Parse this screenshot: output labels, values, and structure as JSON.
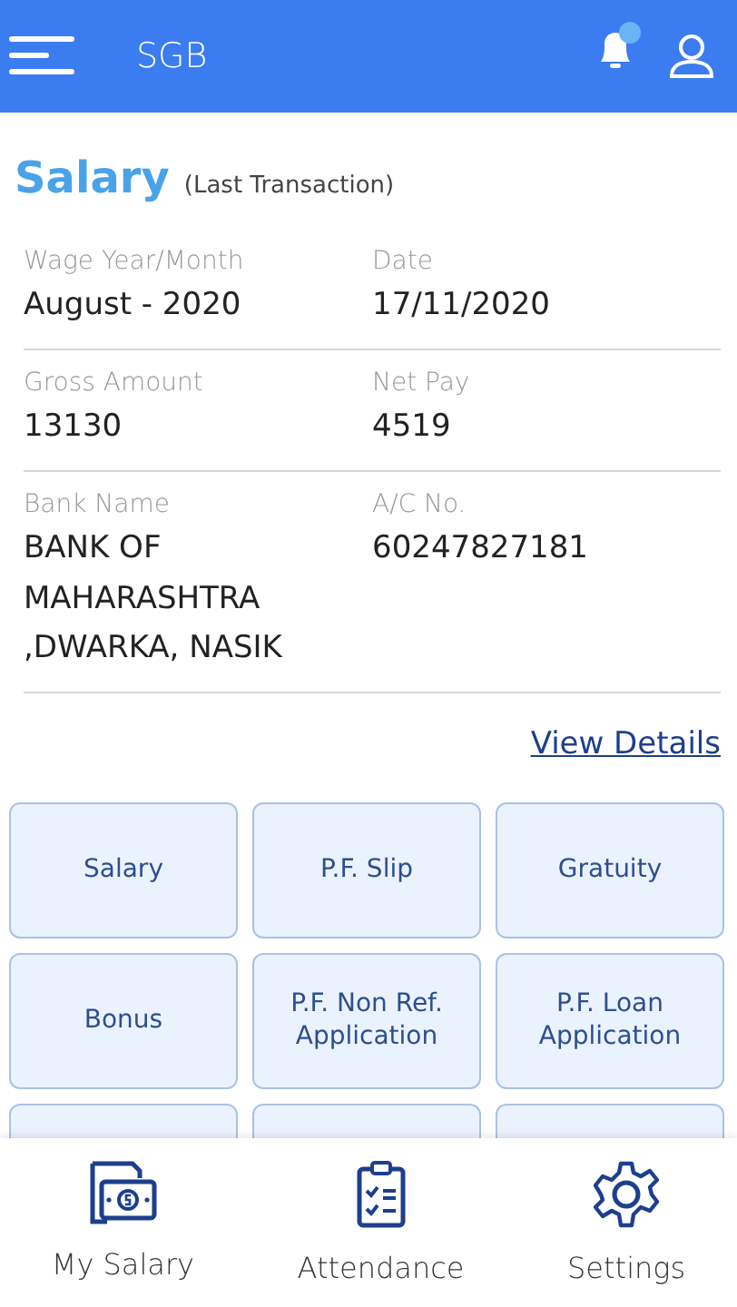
{
  "app_bar": {
    "title": "SGB",
    "notification_badge": true
  },
  "salary": {
    "title": "Salary",
    "subtitle": "(Last Transaction)",
    "rows": [
      [
        {
          "label": "Wage Year/Month",
          "value": "August - 2020"
        },
        {
          "label": "Date",
          "value": "17/11/2020"
        }
      ],
      [
        {
          "label": "Gross Amount",
          "value": "13130"
        },
        {
          "label": "Net Pay",
          "value": "4519"
        }
      ],
      [
        {
          "label": "Bank Name",
          "value": "BANK OF MAHARASHTRA ,DWARKA, NASIK"
        },
        {
          "label": "A/C No.",
          "value": "60247827181"
        }
      ]
    ],
    "link": "View Details"
  },
  "tiles": [
    {
      "kind": "button",
      "label": "Salary"
    },
    {
      "kind": "button",
      "label": "P.F. Slip"
    },
    {
      "kind": "button",
      "label": "Gratuity"
    },
    {
      "kind": "button",
      "label": "Bonus"
    },
    {
      "kind": "button",
      "label": "P.F. Non Ref. Application"
    },
    {
      "kind": "button",
      "label": "P.F. Loan Application"
    },
    {
      "kind": "hidden"
    },
    {
      "kind": "hidden"
    },
    {
      "kind": "hidden"
    }
  ],
  "bottom_nav": [
    {
      "kind": "money",
      "label": "My Salary"
    },
    {
      "kind": "clipboard",
      "label": "Attendance"
    },
    {
      "kind": "gear",
      "label": "Settings"
    }
  ]
}
